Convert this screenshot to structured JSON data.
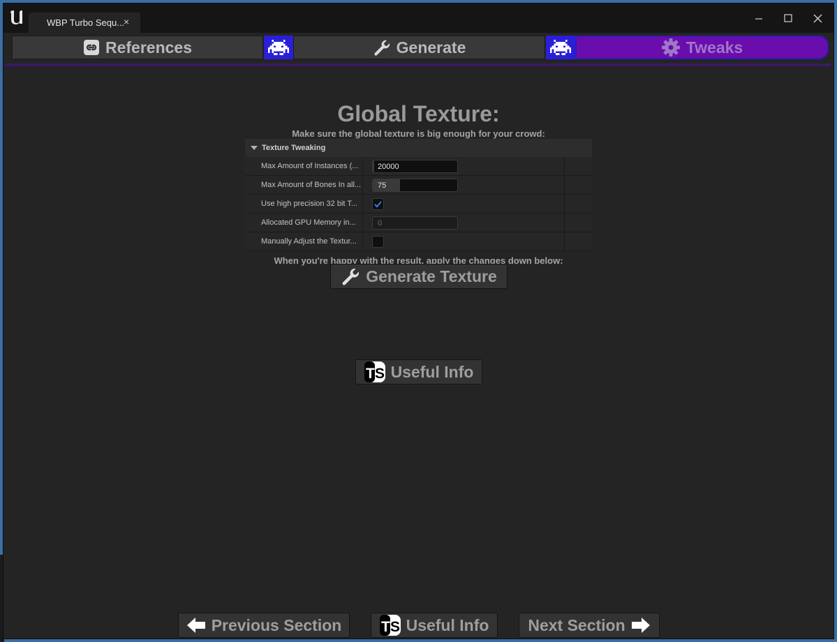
{
  "window": {
    "tab_title": "WBP Turbo Sequ...",
    "tab_close": "×"
  },
  "tabs": [
    {
      "label": "References",
      "active": false
    },
    {
      "label": "Generate",
      "active": false
    },
    {
      "label": "Tweaks",
      "active": true
    }
  ],
  "main": {
    "title": "Global Texture:",
    "subtitle": "Make sure the global texture is big enough for your crowd:",
    "section_header": "Texture Tweaking",
    "properties": [
      {
        "label": "Max Amount of Instances (...",
        "type": "number",
        "value": "20000",
        "fill": 0.02
      },
      {
        "label": "Max Amount of Bones In all...",
        "type": "number",
        "value": "75",
        "fill": 0.32
      },
      {
        "label": "Use high precision 32 bit T...",
        "type": "checkbox",
        "checked": true
      },
      {
        "label": "Allocated GPU Memory in...",
        "type": "number-readonly",
        "value": "0"
      },
      {
        "label": "Manually Adjust the Textur...",
        "type": "checkbox",
        "checked": false
      }
    ],
    "apply_text": "When you're happy with the result, apply the changes down below:",
    "generate_button": "Generate Texture",
    "useful_info_button": "Useful Info"
  },
  "footer": {
    "previous_button": "Previous Section",
    "useful_info_button": "Useful Info",
    "next_button": "Next Section"
  },
  "colors": {
    "active_tab": "#6a0dad",
    "invader_bg": "#2a1fd8",
    "checkbox_check": "#2f7fe8"
  }
}
